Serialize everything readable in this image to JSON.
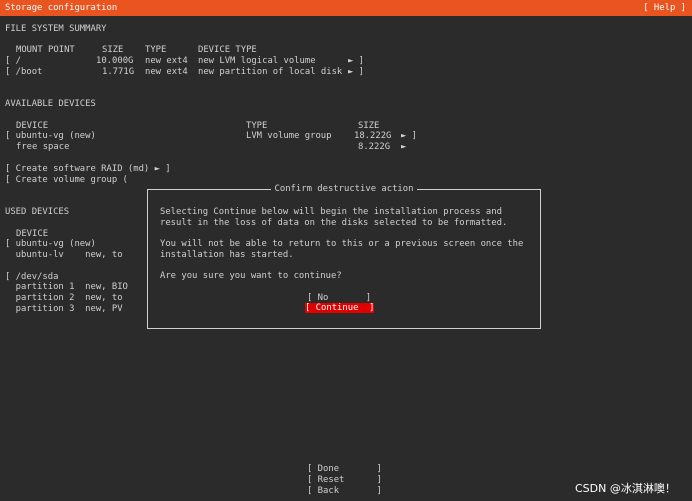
{
  "header": {
    "title": "Storage configuration",
    "help": "[ Help ]"
  },
  "fs_summary": {
    "section": "FILE SYSTEM SUMMARY",
    "columns": [
      "MOUNT POINT",
      "SIZE",
      "TYPE",
      "DEVICE TYPE"
    ],
    "rows": [
      {
        "mount": "[ /",
        "size": "10.000G",
        "type": "new ext4",
        "device_type": "new LVM logical volume",
        "arrow": "► ]"
      },
      {
        "mount": "[ /boot",
        "size": "1.771G",
        "type": "new ext4",
        "device_type": "new partition of local disk",
        "arrow": "► ]"
      }
    ]
  },
  "available": {
    "section": "AVAILABLE DEVICES",
    "columns": [
      "DEVICE",
      "TYPE",
      "SIZE"
    ],
    "rows": [
      {
        "device": "[ ubuntu-vg (new)",
        "type": "LVM volume group",
        "size": "18.222G",
        "arrow": "► ]"
      },
      {
        "device": "free space",
        "type": "",
        "size": "8.222G",
        "arrow": "►"
      }
    ],
    "create_raid": "[ Create software RAID (md) ► ]",
    "create_vg": "[ Create volume group ("
  },
  "used": {
    "section": "USED DEVICES",
    "column": "DEVICE",
    "lines": [
      "[ ubuntu-vg (new)",
      "  ubuntu-lv    new, to",
      "",
      "[ /dev/sda",
      "  partition 1  new, BIO",
      "  partition 2  new, to",
      "  partition 3  new, PV"
    ]
  },
  "dialog": {
    "title": "Confirm destructive action",
    "para1_line1": "Selecting Continue below will begin the installation process and",
    "para1_line2": "result in the loss of data on the disks selected to be formatted.",
    "para2_line1": "You will not be able to return to this or a previous screen once the",
    "para2_line2": "installation has started.",
    "question": "Are you sure you want to continue?",
    "no_button": "[ No       ]",
    "continue_button": "[ Continue  ]"
  },
  "footer": {
    "done": "[ Done       ]",
    "reset": "[ Reset      ]",
    "back": "[ Back       ]"
  },
  "watermark": "CSDN @冰淇淋噢！",
  "colors": {
    "accent": "#e95420",
    "danger": "#e00000",
    "background": "#2b2b2b",
    "text": "#d0d0d0"
  }
}
